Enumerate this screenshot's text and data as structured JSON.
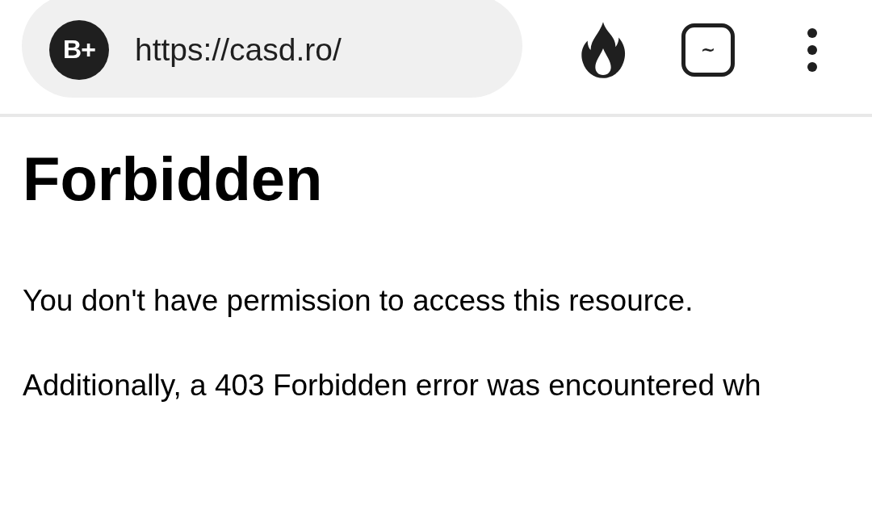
{
  "toolbar": {
    "site_badge": "B+",
    "url": "https://casd.ro/",
    "tab_count": "~"
  },
  "page": {
    "heading": "Forbidden",
    "paragraphs": [
      "You don't have permission to access this resource.",
      "Additionally, a 403 Forbidden error was encountered wh"
    ]
  }
}
